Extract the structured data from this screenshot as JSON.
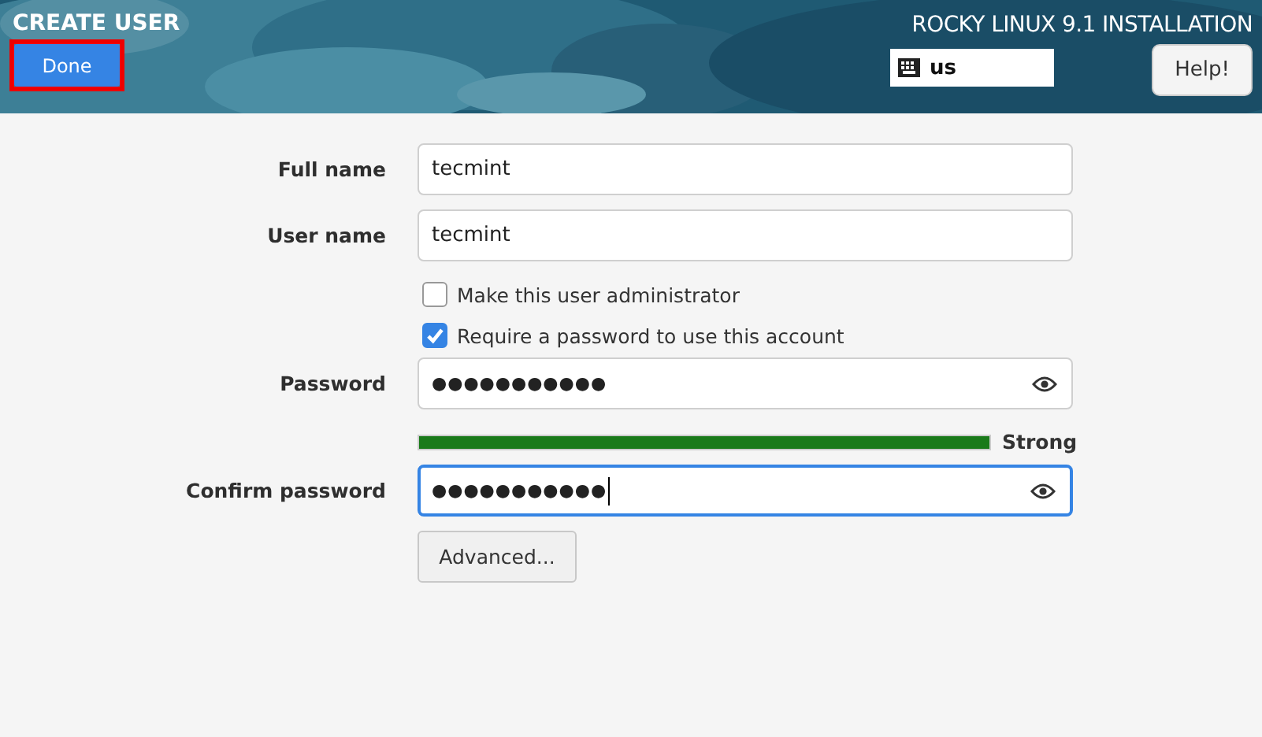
{
  "header": {
    "title": "CREATE USER",
    "done_button": "Done",
    "done_highlighted": true,
    "product": "ROCKY LINUX 9.1 INSTALLATION",
    "keyboard_layout": "us",
    "help_button": "Help!"
  },
  "fields": [
    {
      "kind": "text",
      "label": "Full name",
      "value": "tecmint",
      "focused": false
    },
    {
      "kind": "text",
      "label": "User name",
      "value": "tecmint",
      "focused": false
    },
    {
      "kind": "checkbox",
      "label": "Make this user administrator",
      "checked": false
    },
    {
      "kind": "checkbox",
      "label": "Require a password to use this account",
      "checked": true
    },
    {
      "kind": "password",
      "label": "Password",
      "value": "●●●●●●●●●●●",
      "focused": false
    },
    {
      "kind": "meter",
      "level": 1,
      "reading": "Strong"
    },
    {
      "kind": "password",
      "label": "Confirm password",
      "value": "●●●●●●●●●●●",
      "focused": true
    },
    {
      "kind": "button",
      "label": "Advanced..."
    }
  ]
}
